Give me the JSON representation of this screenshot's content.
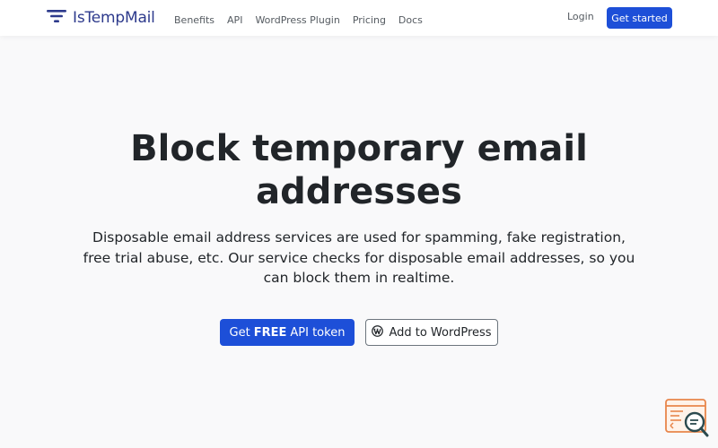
{
  "brand": {
    "name": "IsTempMail",
    "color": "#2d3a8c",
    "icon": "filter-lines-icon"
  },
  "nav": {
    "links": [
      "Benefits",
      "API",
      "WordPress Plugin",
      "Pricing",
      "Docs"
    ],
    "login_label": "Login",
    "cta_label": "Get started"
  },
  "hero": {
    "title": "Block temporary email addresses",
    "description": "Disposable email address services are used for spamming, fake registration, free trial abuse, etc. Our service checks for disposable email addresses, so you can block them in realtime.",
    "primary_button": {
      "prefix": "Get",
      "bold": "FREE",
      "suffix": "API token"
    },
    "secondary_button": {
      "label": "Add to WordPress",
      "icon": "wordpress-icon"
    }
  },
  "colors": {
    "accent": "#1d4fd8",
    "badge": "#e8864b"
  }
}
